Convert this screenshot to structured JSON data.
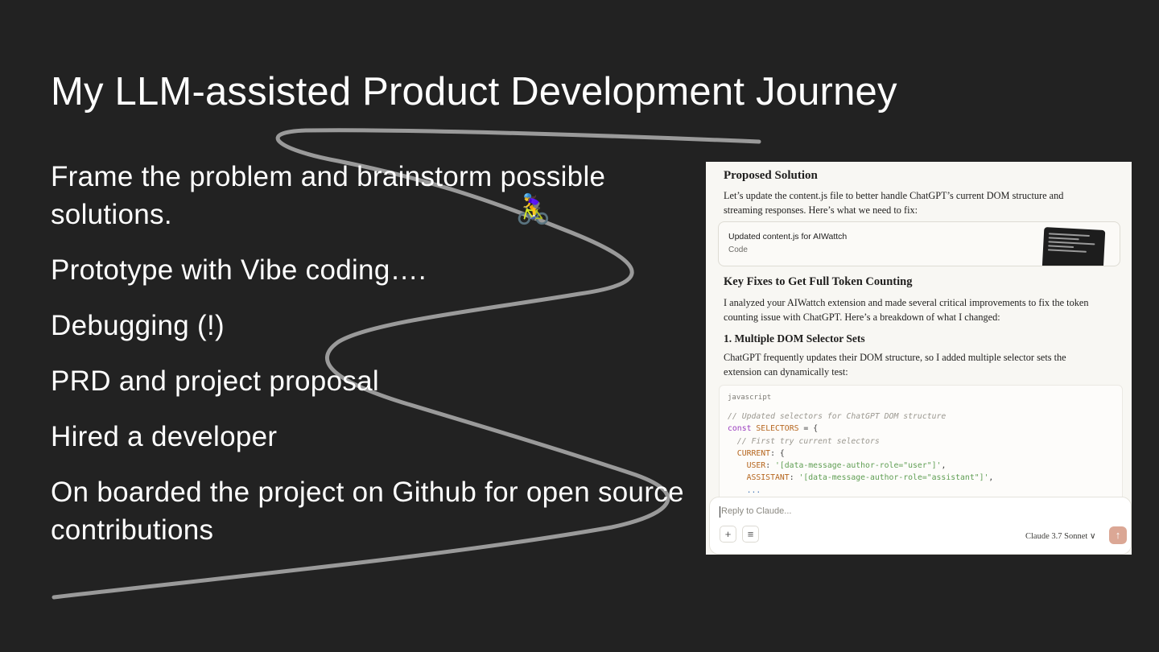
{
  "slide": {
    "title": "My LLM-assisted Product Development Journey",
    "bullets": [
      "Frame the problem and brainstorm possible solutions.",
      "Prototype with Vibe coding….",
      "Debugging (!)",
      "PRD and project proposal",
      "Hired a developer",
      "On boarded the project on Github for open source contributions"
    ],
    "cyclist_emoji": "🚴‍♀️",
    "path_color": "#9a9a9a"
  },
  "chat": {
    "proposed_heading": "Proposed Solution",
    "proposed_text": "Let’s update the content.js file to better handle ChatGPT’s current DOM structure and streaming responses. Here’s what we need to fix:",
    "artifact": {
      "title": "Updated content.js for AIWattch",
      "subtitle": "Code"
    },
    "fixes_heading": "Key Fixes to Get Full Token Counting",
    "fixes_text": "I analyzed your AIWattch extension and made several critical improvements to fix the token counting issue with ChatGPT. Here’s a breakdown of what I changed:",
    "multi_heading": "1. Multiple DOM Selector Sets",
    "multi_text": "ChatGPT frequently updates their DOM structure, so I added multiple selector sets the extension can dynamically test:",
    "code": {
      "language": "javascript",
      "line1_comment": "// Updated selectors for ChatGPT DOM structure",
      "line2_kw": "const",
      "line2_var": "SELECTORS",
      "line2_rest": " = {",
      "line3_comment": "  // First try current selectors",
      "line4_key": "  CURRENT",
      "line4_rest": ": {",
      "line5_key": "    USER",
      "line5_sep": ": ",
      "line5_str": "'[data-message-author-role=\"user\"]'",
      "line5_end": ",",
      "line6_key": "    ASSISTANT",
      "line6_sep": ": ",
      "line6_str": "'[data-message-author-role=\"assistant\"]'",
      "line6_end": ",",
      "line7_dots": "    ..."
    },
    "input_placeholder": "Reply to Claude...",
    "add_button": "+",
    "tools_button": "≡",
    "model_label": "Claude 3.7 Sonnet ∨",
    "send_button": "↑",
    "send_color": "#dba795"
  }
}
